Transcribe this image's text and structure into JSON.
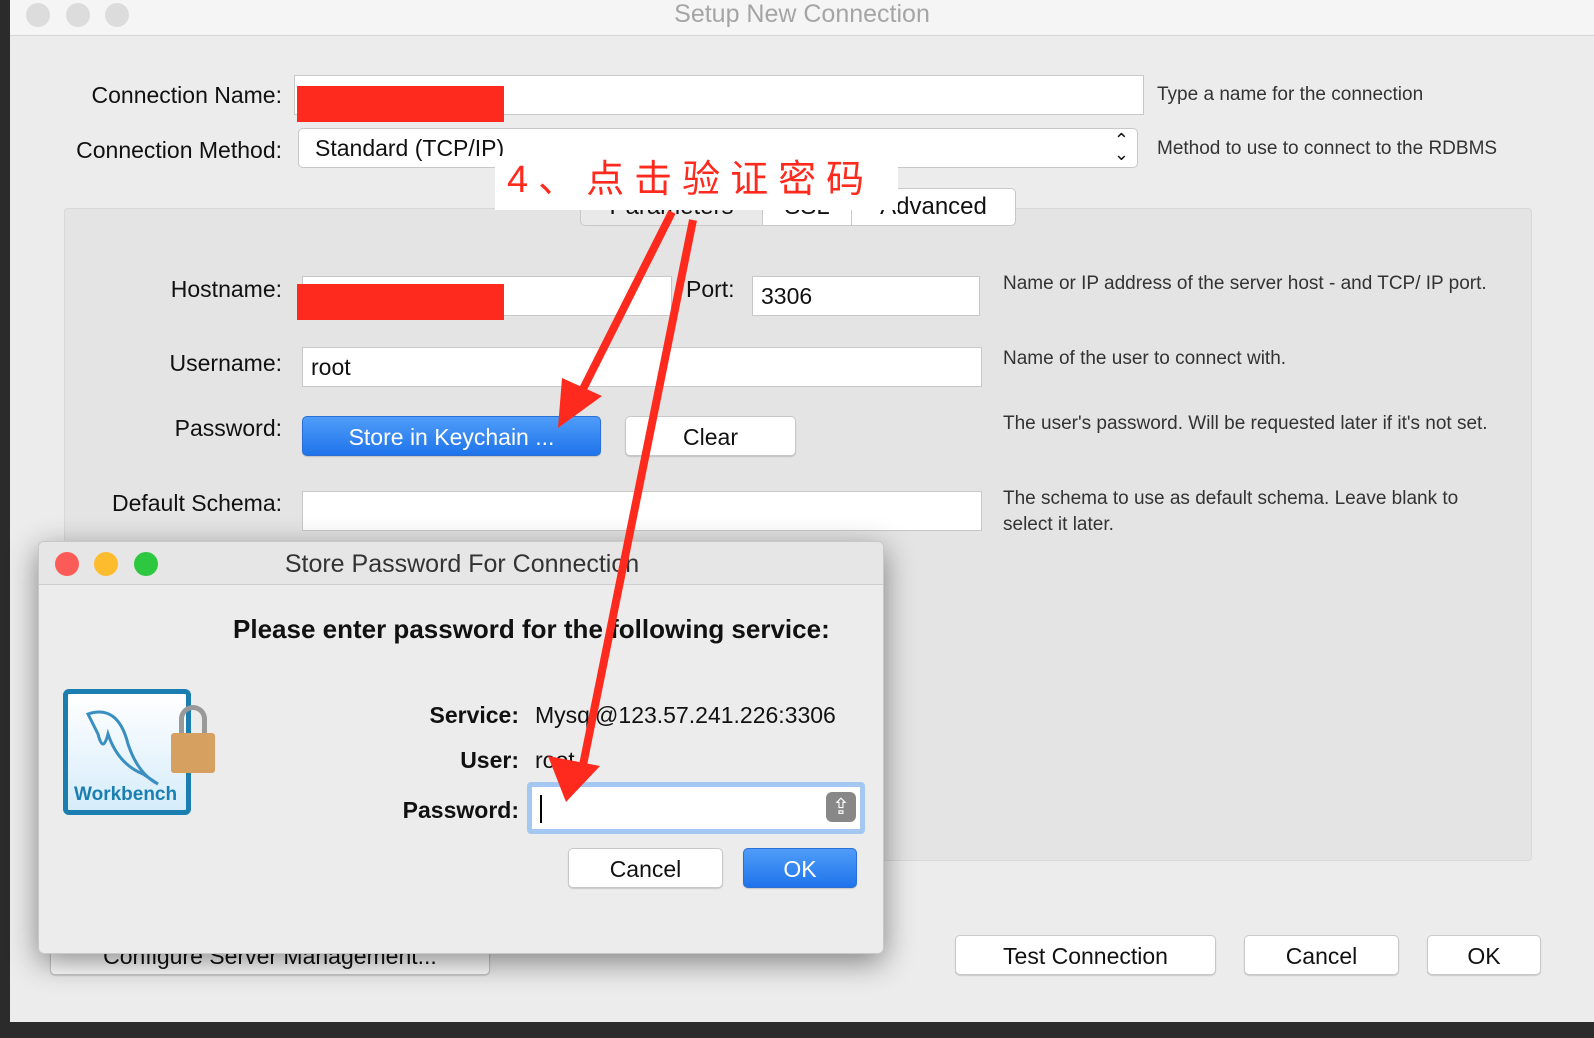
{
  "window": {
    "title": "Setup New Connection"
  },
  "form": {
    "connection_name_label": "Connection Name:",
    "connection_name_hint": "Type a name for the connection",
    "connection_method_label": "Connection Method:",
    "connection_method_value": "Standard (TCP/IP)",
    "connection_method_hint": "Method to use to connect to the RDBMS",
    "tabs": [
      {
        "label": "Parameters"
      },
      {
        "label": "SSL"
      },
      {
        "label": "Advanced"
      }
    ],
    "hostname_label": "Hostname:",
    "port_label": "Port:",
    "port_value": "3306",
    "hostname_hint": "Name or IP address of the server host - and TCP/ IP port.",
    "username_label": "Username:",
    "username_value": "root",
    "username_hint": "Name of the user to connect with.",
    "password_label": "Password:",
    "store_keychain_label": "Store in Keychain ...",
    "clear_label": "Clear",
    "password_hint": "The user's password. Will be requested later if it's not set.",
    "schema_label": "Default Schema:",
    "schema_hint": "The schema to use as default schema. Leave blank to select it later."
  },
  "footer": {
    "configure_label": "Configure Server Management...",
    "test_label": "Test Connection",
    "cancel_label": "Cancel",
    "ok_label": "OK"
  },
  "dialog": {
    "title": "Store Password For Connection",
    "heading": "Please enter password for the following service:",
    "service_label": "Service:",
    "service_value": "Mysql@123.57.241.226:3306",
    "user_label": "User:",
    "user_value": "root",
    "password_label": "Password:",
    "password_value": "",
    "cancel_label": "Cancel",
    "ok_label": "OK",
    "logo_text": "MySQL Workbench"
  },
  "annotation": {
    "text": "4、点击验证密码",
    "color": "#ff2a1e"
  },
  "colors": {
    "accent": "#1f74ea",
    "redaction": "#ff2a1e"
  }
}
